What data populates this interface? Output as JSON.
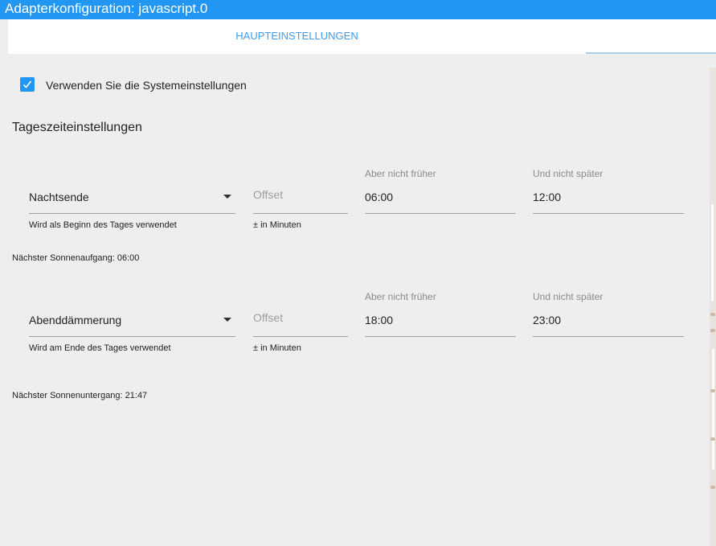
{
  "window": {
    "title": "Adapterkonfiguration: javascript.0"
  },
  "tabs": [
    {
      "label": "HAUPTEINSTELLUNGEN",
      "active": true
    }
  ],
  "system_settings": {
    "label": "Verwenden Sie die Systemeinstellungen",
    "checked": true
  },
  "section": {
    "title": "Tageszeiteinstellungen"
  },
  "day_start": {
    "select_value": "Nachtsende",
    "select_helper": "Wird als Beginn des Tages verwendet",
    "offset_placeholder": "Offset",
    "offset_helper": "± in Minuten",
    "not_earlier_label": "Aber nicht früher",
    "not_earlier_value": "06:00",
    "not_later_label": "Und nicht später",
    "not_later_value": "12:00",
    "info": "Nächster Sonnenaufgang: 06:00"
  },
  "day_end": {
    "select_value": "Abenddämmerung",
    "select_helper": "Wird am Ende des Tages verwendet",
    "offset_placeholder": "Offset",
    "offset_helper": "± in Minuten",
    "not_earlier_label": "Aber nicht früher",
    "not_earlier_value": "18:00",
    "not_later_label": "Und nicht später",
    "not_later_value": "23:00",
    "info": "Nächster Sonnenuntergang: 21:47"
  },
  "colors": {
    "accent": "#2196f3",
    "background": "#eeeeee",
    "tab_text": "#3f9bf0"
  },
  "icons": {
    "checkbox": "check-icon",
    "dropdown": "caret-down-icon"
  }
}
